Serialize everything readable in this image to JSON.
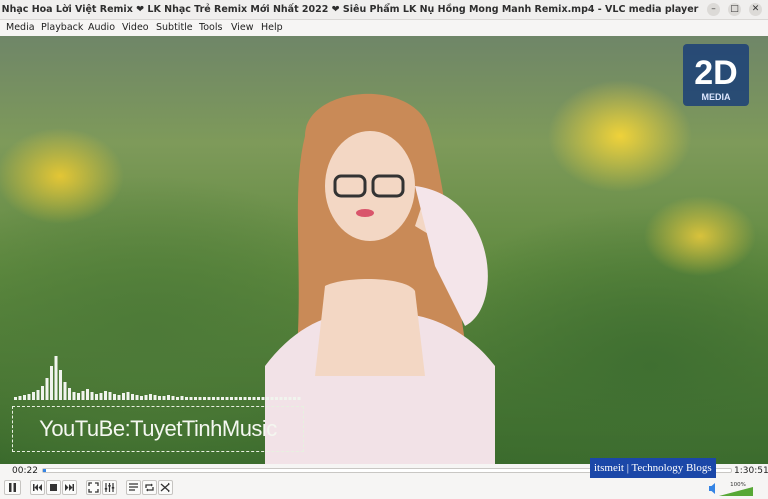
{
  "window": {
    "title": "Nhạc Hoa Lời Việt Remix ❤ LK Nhạc Trẻ Remix Mới Nhất 2022 ❤ Siêu Phẩm LK Nụ Hồng Mong Manh Remix.mp4 - VLC media player",
    "minimize": "–",
    "maximize": "□",
    "close": "✕"
  },
  "menu": {
    "media": "Media",
    "playback": "Playback",
    "audio": "Audio",
    "video": "Video",
    "subtitle": "Subtitle",
    "tools": "Tools",
    "view": "View",
    "help": "Help"
  },
  "video": {
    "logo_text": "2D",
    "logo_sub": "MEDIA",
    "channel": "YouTuBe:TuyetTinhMusic",
    "watermark": "itsmeit | Technology Blogs"
  },
  "player": {
    "elapsed": "00:22",
    "total": "1:30:51",
    "progress": 0.004,
    "volume_label": "100%",
    "volume": 1.0,
    "accent": "#3584e4"
  }
}
